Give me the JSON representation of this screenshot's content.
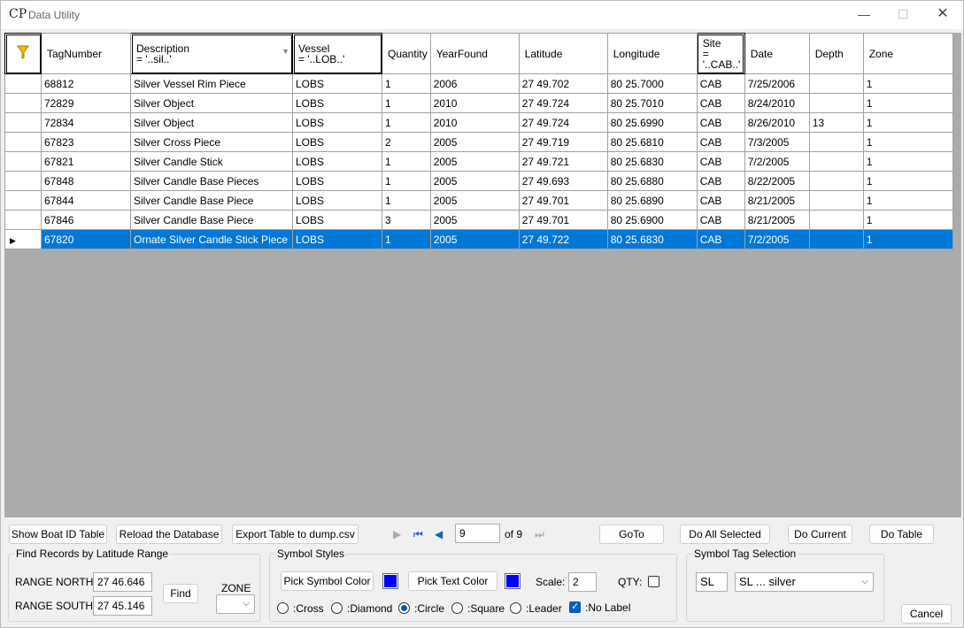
{
  "window": {
    "title": "Data Utility",
    "app_icon": "CP"
  },
  "grid": {
    "columns": [
      {
        "label": "TagNumber",
        "filter": ""
      },
      {
        "label": "Description",
        "filter": " = '..sil..'"
      },
      {
        "label": "Vessel",
        "filter": " = '..LOB..'"
      },
      {
        "label": "Quantity",
        "filter": ""
      },
      {
        "label": "YearFound",
        "filter": ""
      },
      {
        "label": "Latitude",
        "filter": ""
      },
      {
        "label": "Longitude",
        "filter": ""
      },
      {
        "label": "Site",
        "filter": "=",
        "filter2": "'..CAB..'"
      },
      {
        "label": "Date",
        "filter": ""
      },
      {
        "label": "Depth",
        "filter": ""
      },
      {
        "label": "Zone",
        "filter": ""
      }
    ],
    "rows": [
      [
        "68812",
        "Silver Vessel Rim Piece",
        "LOBS",
        "1",
        "2006",
        "27 49.702",
        "80 25.7000",
        "CAB",
        "7/25/2006",
        "",
        "1"
      ],
      [
        "72829",
        "Silver Object",
        "LOBS",
        "1",
        "2010",
        "27 49.724",
        "80 25.7010",
        "CAB",
        "8/24/2010",
        "",
        "1"
      ],
      [
        "72834",
        "Silver Object",
        "LOBS",
        "1",
        "2010",
        "27 49.724",
        "80 25.6990",
        "CAB",
        "8/26/2010",
        "13",
        "1"
      ],
      [
        "67823",
        "Silver Cross Piece",
        "LOBS",
        "2",
        "2005",
        "27 49.719",
        "80 25.6810",
        "CAB",
        "7/3/2005",
        "",
        "1"
      ],
      [
        "67821",
        "Silver Candle Stick",
        "LOBS",
        "1",
        "2005",
        "27 49.721",
        "80 25.6830",
        "CAB",
        "7/2/2005",
        "",
        "1"
      ],
      [
        "67848",
        "Silver Candle Base Pieces",
        "LOBS",
        "1",
        "2005",
        "27 49.693",
        "80 25.6880",
        "CAB",
        "8/22/2005",
        "",
        "1"
      ],
      [
        "67844",
        "Silver Candle Base Piece",
        "LOBS",
        "1",
        "2005",
        "27 49.701",
        "80 25.6890",
        "CAB",
        "8/21/2005",
        "",
        "1"
      ],
      [
        "67846",
        "Silver Candle Base Piece",
        "LOBS",
        "3",
        "2005",
        "27 49.701",
        "80 25.6900",
        "CAB",
        "8/21/2005",
        "",
        "1"
      ],
      [
        "67820",
        "Ornate Silver Candle Stick Piece",
        "LOBS",
        "1",
        "2005",
        "27 49.722",
        "80 25.6830",
        "CAB",
        "7/2/2005",
        "",
        "1"
      ]
    ],
    "selected_row": 8,
    "selection_color": "#0078d7"
  },
  "toolbar": {
    "show_boat_id": "Show Boat ID Table",
    "reload_db": "Reload the Database",
    "export_table": "Export Table to dump.csv",
    "page_current": "9",
    "page_of": "of 9",
    "goto": "GoTo",
    "do_all_selected": "Do All Selected",
    "do_current": "Do Current",
    "do_table": "Do Table"
  },
  "find_group": {
    "title": "Find Records by Latitude Range",
    "range_north_label": "RANGE NORTH:",
    "range_north_value": "27 46.646",
    "range_south_label": "RANGE SOUTH:",
    "range_south_value": "27 45.146",
    "find_button": "Find",
    "zone_label": "ZONE",
    "zone_value": ""
  },
  "symbol_styles": {
    "title": "Symbol Styles",
    "pick_symbol_color": "Pick Symbol Color",
    "pick_text_color": "Pick Text Color",
    "symbol_color": "#0000ff",
    "text_color": "#0000ff",
    "scale_label": "Scale:",
    "scale_value": "2",
    "qty_label": "QTY:",
    "qty_checked": false,
    "styles": [
      {
        "label": ":Cross",
        "checked": false
      },
      {
        "label": ":Diamond",
        "checked": false
      },
      {
        "label": ":Circle",
        "checked": true
      },
      {
        "label": ":Square",
        "checked": false
      },
      {
        "label": ":Leader",
        "checked": false
      }
    ],
    "no_label": ":No Label",
    "no_label_checked": true
  },
  "symbol_tag": {
    "title": "Symbol Tag Selection",
    "code_value": "SL",
    "selected_option": "SL ... silver"
  },
  "cancel_button": "Cancel"
}
